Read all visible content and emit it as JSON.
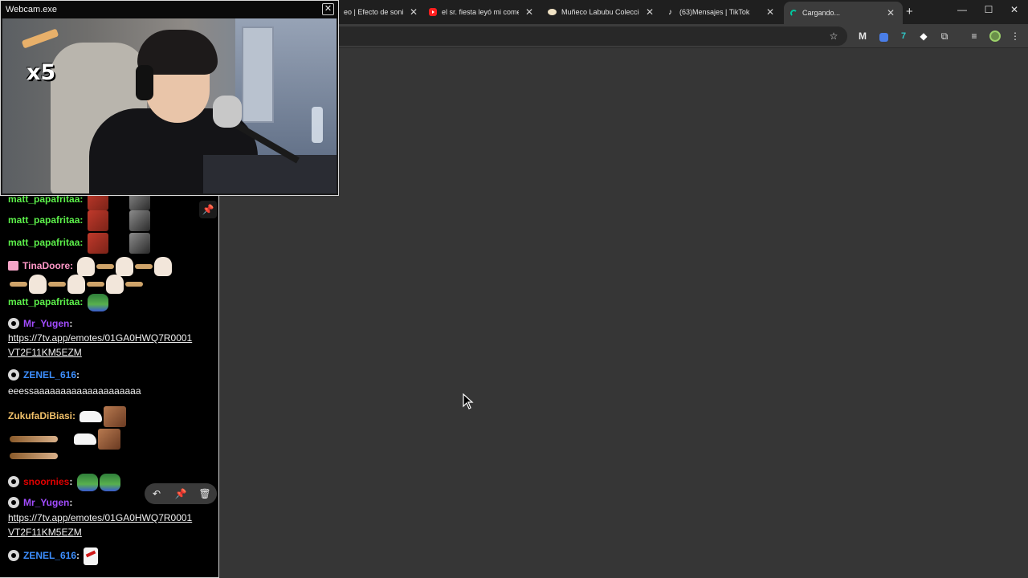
{
  "browser": {
    "tabs": [
      {
        "title": "eo | Efecto de sonid",
        "favicon": "speaker-icon",
        "active": false
      },
      {
        "title": "el sr. fiesta leyó mi comen",
        "favicon": "youtube-icon",
        "active": false
      },
      {
        "title": "Muñeco Labubu Coleccion",
        "favicon": "shop-icon",
        "active": false
      },
      {
        "title": "(63)Mensajes | TikTok",
        "favicon": "tiktok-icon",
        "active": false
      },
      {
        "title": "Cargando...",
        "favicon": "loading-icon",
        "active": true
      }
    ],
    "close_glyph": "✕",
    "new_tab_glyph": "+",
    "window_controls": {
      "minimize": "—",
      "maximize": "☐",
      "close": "✕"
    }
  },
  "webcam_window": {
    "title": "Webcam.exe",
    "close_glyph": "✕",
    "overlay_text": "x5"
  },
  "chat": {
    "messages": [
      {
        "user": "matt_papafritaa",
        "color": "#5cf04a",
        "text": "",
        "emotes": [
          "face",
          "dark"
        ]
      },
      {
        "user": "matt_papafritaa",
        "color": "#5cf04a",
        "text": "",
        "emotes": [
          "face",
          "dark"
        ]
      },
      {
        "user": "matt_papafritaa",
        "color": "#5cf04a",
        "text": "",
        "emotes": [
          "face",
          "dark"
        ]
      },
      {
        "user": "TinaDoore",
        "color": "#ff98c8",
        "text": "",
        "emotes": [
          "bunny",
          "stick",
          "bunny",
          "stick",
          "bunny"
        ]
      },
      {
        "user": "matt_papafritaa",
        "color": "#5cf04a",
        "text": "",
        "emotes": [
          "frog"
        ]
      },
      {
        "user": "Mr_Yugen",
        "color": "#a24cff",
        "text": "https://7tv.app/emotes/01GA0HWQ7R0001VT2F11KM5EZM"
      },
      {
        "user": "ZENEL_616",
        "color": "#3d8fff",
        "text": "eeessaaaaaaaaaaaaaaaaaaaa"
      },
      {
        "user": "ZukufaDiBiasi",
        "color": "#f2c16a",
        "text": "",
        "emotes": [
          "shoe",
          "dog",
          "cig"
        ]
      },
      {
        "user": "snoornies",
        "color": "#e20000",
        "text": "",
        "emotes": [
          "frog",
          "frog"
        ]
      },
      {
        "user": "Mr_Yugen",
        "color": "#a24cff",
        "text": "https://7tv.app/emotes/01GA0HWQ7R0001VT2F11KM5EZM"
      },
      {
        "user": "ZENEL_616",
        "color": "#3d8fff",
        "text": "",
        "emotes": [
          "shirt"
        ]
      }
    ],
    "link_line1": "https://7tv.app/emotes/01GA0HWQ7R0001",
    "link_line2": "VT2F11KM5EZM",
    "colon": ":",
    "action_icons": [
      "undo-icon",
      "pin-icon",
      "trash-icon"
    ]
  }
}
